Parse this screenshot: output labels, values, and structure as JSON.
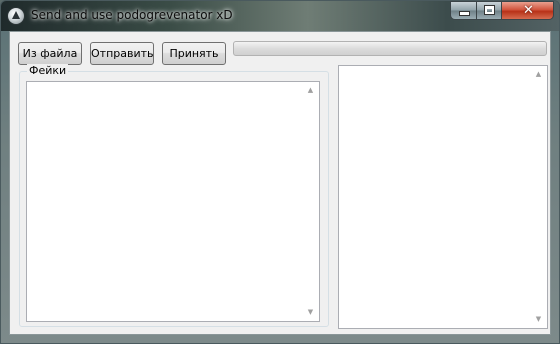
{
  "window": {
    "title": "Send and use podogrevenator xD",
    "icon": "app-icon",
    "controls": {
      "minimize_icon": "minimize-icon",
      "maximize_icon": "maximize-icon",
      "close_glyph": "✕"
    }
  },
  "toolbar": {
    "from_file_label": "Из файла",
    "send_label": "Отправить",
    "receive_label": "Принять"
  },
  "progress": {
    "value": 0,
    "fill_color": "#06b025"
  },
  "group": {
    "label": "Фейки",
    "textbox_value": ""
  },
  "right_panel": {
    "textbox_value": ""
  },
  "scroll": {
    "up_glyph": "▲",
    "down_glyph": "▼"
  },
  "colors": {
    "close_button": "#c7452a",
    "client_bg": "#f0f0f0"
  }
}
